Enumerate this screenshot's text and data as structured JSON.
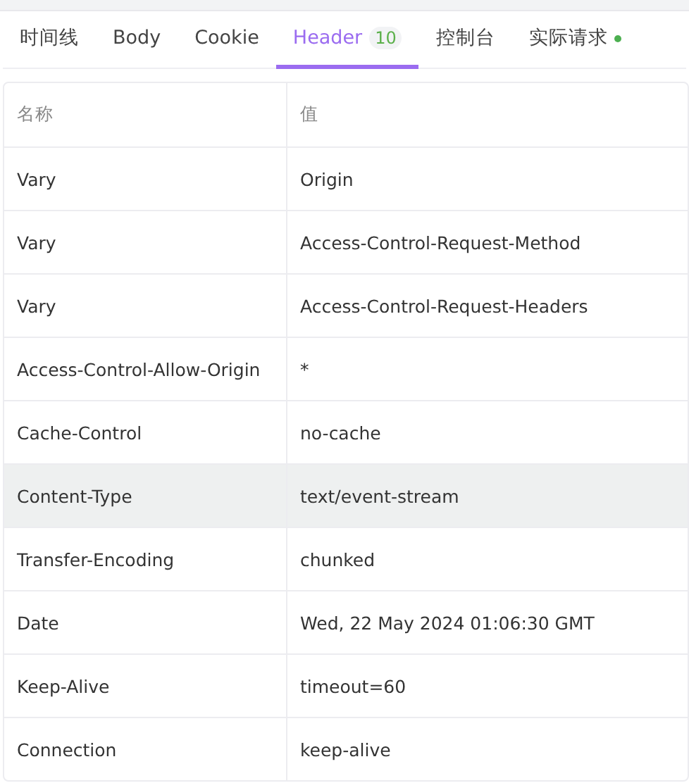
{
  "tabs": [
    {
      "label": "时间线",
      "selected": false,
      "dot": false
    },
    {
      "label": "Body",
      "selected": false,
      "dot": false
    },
    {
      "label": "Cookie",
      "selected": false,
      "dot": false
    },
    {
      "label": "Header",
      "badge": "10",
      "selected": true,
      "dot": false
    },
    {
      "label": "控制台",
      "selected": false,
      "dot": false
    },
    {
      "label": "实际请求",
      "selected": false,
      "dot": true
    }
  ],
  "table": {
    "columns": [
      "名称",
      "值"
    ],
    "rows": [
      {
        "name": "Vary",
        "value": "Origin",
        "selected": false
      },
      {
        "name": "Vary",
        "value": "Access-Control-Request-Method",
        "selected": false
      },
      {
        "name": "Vary",
        "value": "Access-Control-Request-Headers",
        "selected": false
      },
      {
        "name": "Access-Control-Allow-Origin",
        "value": "*",
        "selected": false
      },
      {
        "name": "Cache-Control",
        "value": "no-cache",
        "selected": false
      },
      {
        "name": "Content-Type",
        "value": "text/event-stream",
        "selected": true
      },
      {
        "name": "Transfer-Encoding",
        "value": "chunked",
        "selected": false
      },
      {
        "name": "Date",
        "value": "Wed, 22 May 2024 01:06:30 GMT",
        "selected": false
      },
      {
        "name": "Keep-Alive",
        "value": "timeout=60",
        "selected": false
      },
      {
        "name": "Connection",
        "value": "keep-alive",
        "selected": false
      }
    ]
  }
}
